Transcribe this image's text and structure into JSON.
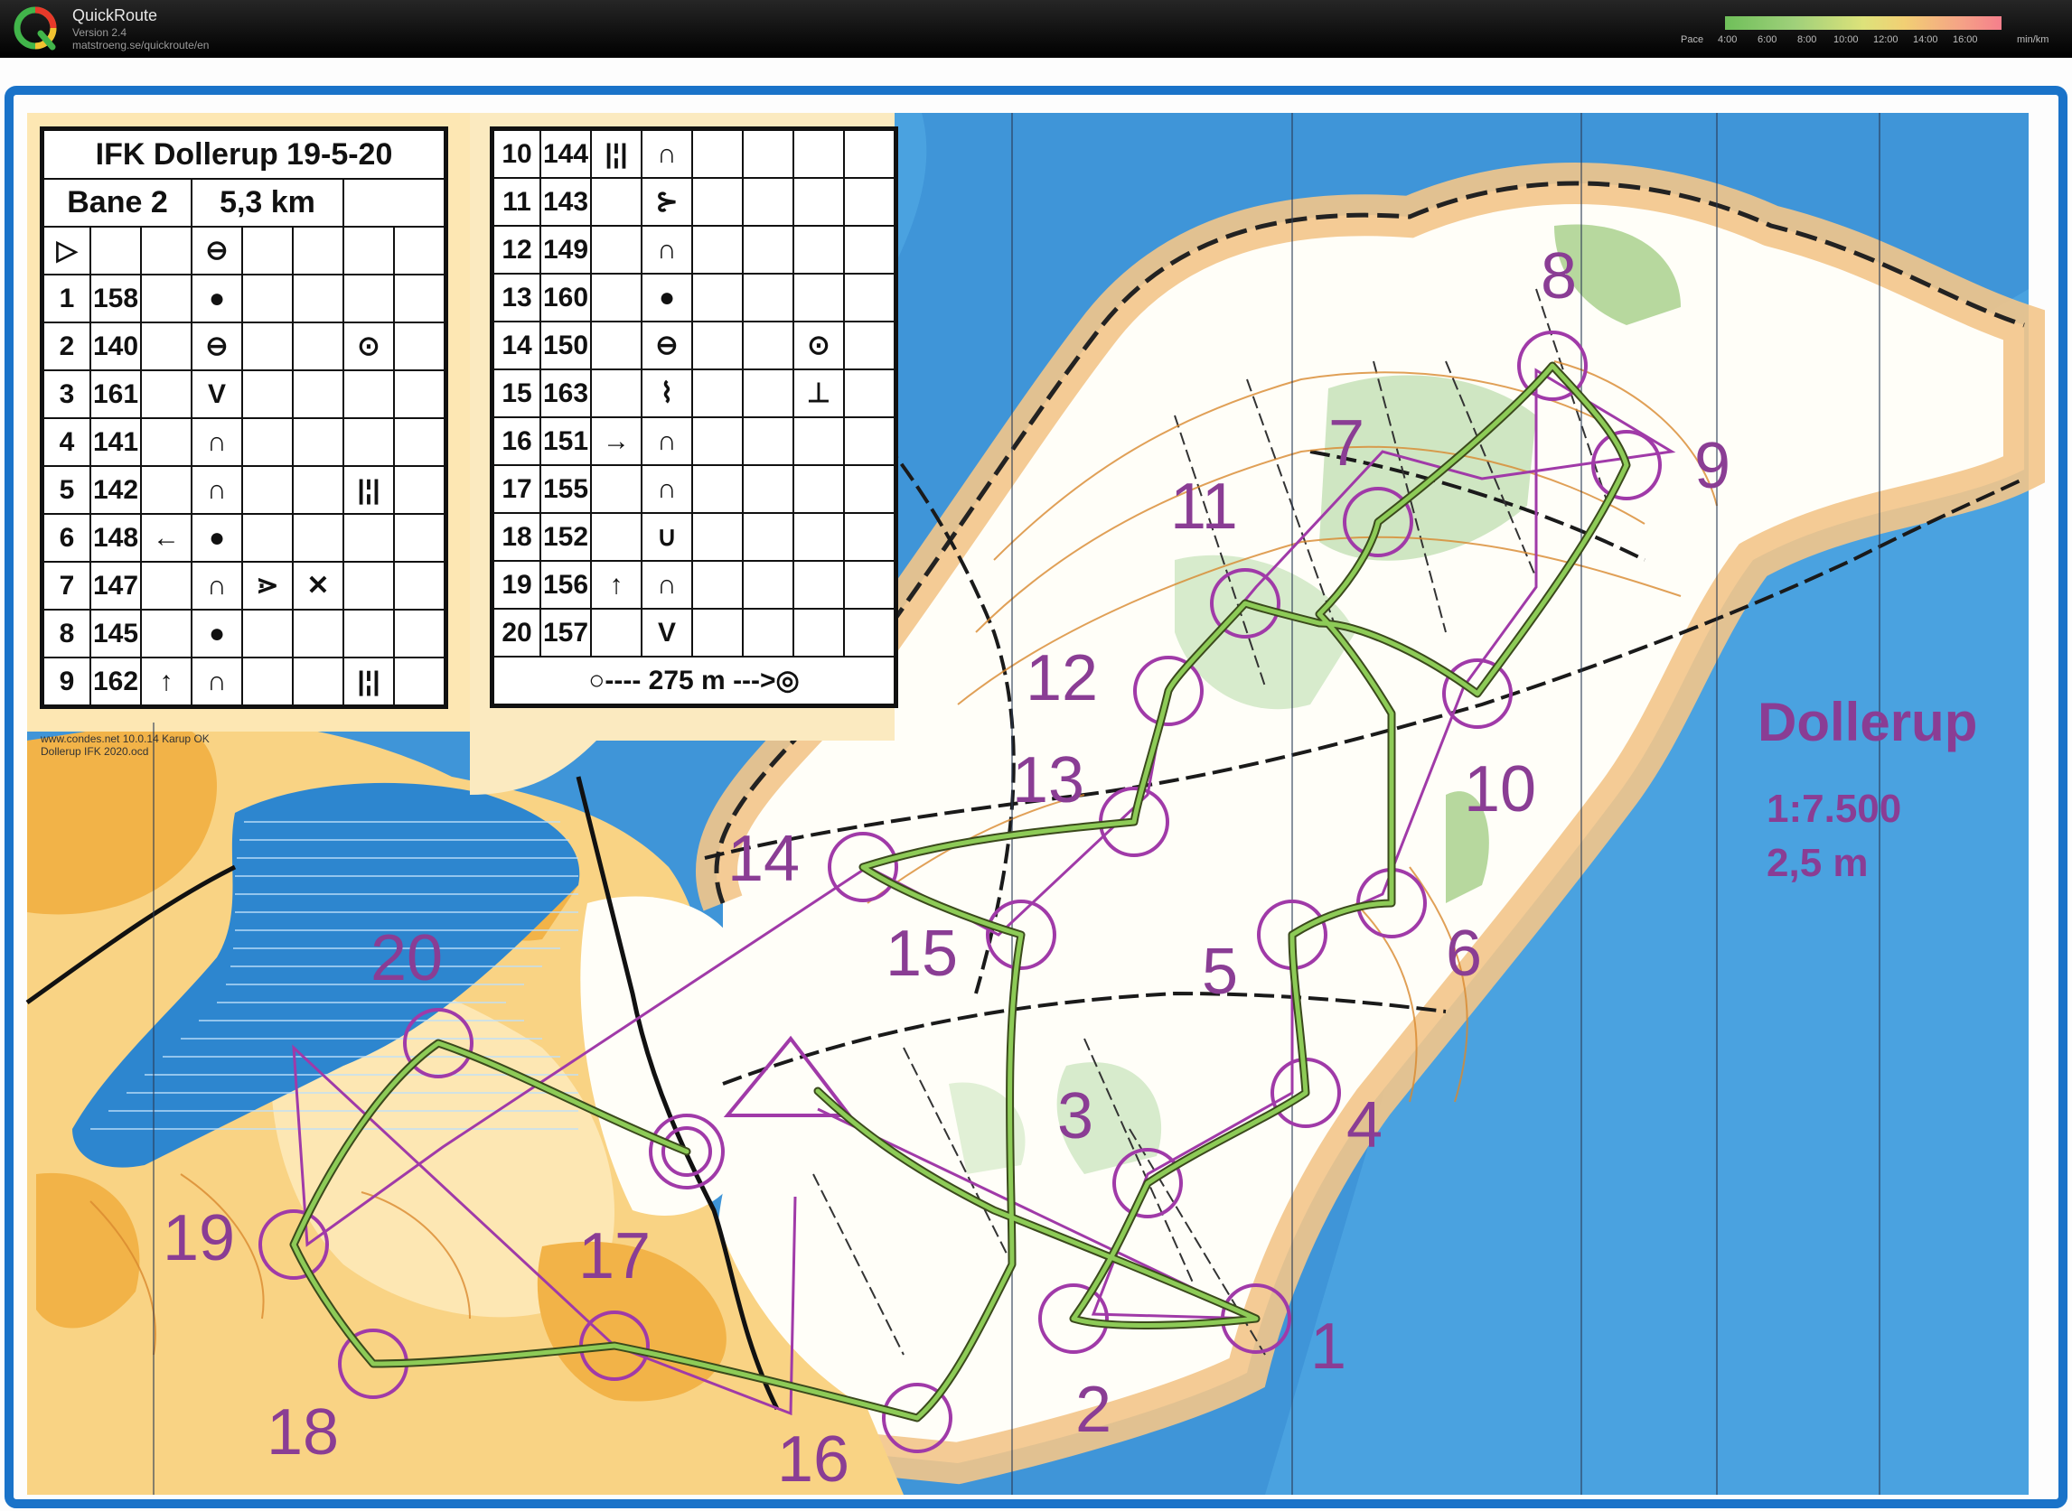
{
  "app": {
    "name": "QuickRoute",
    "version": "Version 2.4",
    "url": "matstroeng.se/quickroute/en"
  },
  "pace_legend": {
    "label": "Pace",
    "ticks": [
      "4:00",
      "6:00",
      "8:00",
      "10:00",
      "12:00",
      "14:00",
      "16:00"
    ],
    "unit": "min/km"
  },
  "map": {
    "name": "Dollerup",
    "scale": "1:7.500",
    "contour_interval": "2,5 m",
    "credit_line1": "www.condes.net 10.0.14 Karup OK",
    "credit_line2": "Dollerup IFK 2020.ocd",
    "control_numbers": [
      "1",
      "2",
      "3",
      "4",
      "5",
      "6",
      "7",
      "8",
      "9",
      "10",
      "11",
      "12",
      "13",
      "14",
      "15",
      "16",
      "17",
      "18",
      "19",
      "20"
    ]
  },
  "description_sheet": {
    "event": "IFK Dollerup 19-5-20",
    "course": "Bane 2",
    "length": "5,3 km",
    "start_symbol": "▷",
    "rows_part1": [
      {
        "num": "1",
        "code": "158",
        "col_d": "",
        "col_e": "●",
        "col_f": "",
        "col_g": "",
        "col_h": ""
      },
      {
        "num": "2",
        "code": "140",
        "col_d": "",
        "col_e": "⊖",
        "col_f": "",
        "col_g": "",
        "col_h": "⊙"
      },
      {
        "num": "3",
        "code": "161",
        "col_d": "",
        "col_e": "V",
        "col_f": "",
        "col_g": "",
        "col_h": ""
      },
      {
        "num": "4",
        "code": "141",
        "col_d": "",
        "col_e": "∩",
        "col_f": "",
        "col_g": "",
        "col_h": ""
      },
      {
        "num": "5",
        "code": "142",
        "col_d": "",
        "col_e": "∩",
        "col_f": "",
        "col_g": "",
        "col_h": "|¦|"
      },
      {
        "num": "6",
        "code": "148",
        "col_d": "←",
        "col_e": "●",
        "col_f": "",
        "col_g": "",
        "col_h": ""
      },
      {
        "num": "7",
        "code": "147",
        "col_d": "",
        "col_e": "∩",
        "col_f": "⋗",
        "col_g": "✕",
        "col_h": ""
      },
      {
        "num": "8",
        "code": "145",
        "col_d": "",
        "col_e": "●",
        "col_f": "",
        "col_g": "",
        "col_h": ""
      },
      {
        "num": "9",
        "code": "162",
        "col_d": "↑",
        "col_e": "∩",
        "col_f": "",
        "col_g": "",
        "col_h": "|¦|"
      }
    ],
    "rows_part2": [
      {
        "num": "10",
        "code": "144",
        "col_d": "|¦|",
        "col_e": "∩",
        "col_f": "",
        "col_g": "",
        "col_h": ""
      },
      {
        "num": "11",
        "code": "143",
        "col_d": "",
        "col_e": "⊱",
        "col_f": "",
        "col_g": "",
        "col_h": ""
      },
      {
        "num": "12",
        "code": "149",
        "col_d": "",
        "col_e": "∩",
        "col_f": "",
        "col_g": "",
        "col_h": ""
      },
      {
        "num": "13",
        "code": "160",
        "col_d": "",
        "col_e": "●",
        "col_f": "",
        "col_g": "",
        "col_h": ""
      },
      {
        "num": "14",
        "code": "150",
        "col_d": "",
        "col_e": "⊖",
        "col_f": "",
        "col_g": "",
        "col_h": "⊙"
      },
      {
        "num": "15",
        "code": "163",
        "col_d": "",
        "col_e": "⌇",
        "col_f": "",
        "col_g": "",
        "col_h": "⊥"
      },
      {
        "num": "16",
        "code": "151",
        "col_d": "→",
        "col_e": "∩",
        "col_f": "",
        "col_g": "",
        "col_h": ""
      },
      {
        "num": "17",
        "code": "155",
        "col_d": "",
        "col_e": "∩",
        "col_f": "",
        "col_g": "",
        "col_h": ""
      },
      {
        "num": "18",
        "code": "152",
        "col_d": "",
        "col_e": "∪",
        "col_f": "",
        "col_g": "",
        "col_h": ""
      },
      {
        "num": "19",
        "code": "156",
        "col_d": "↑",
        "col_e": "∩",
        "col_f": "",
        "col_g": "",
        "col_h": ""
      },
      {
        "num": "20",
        "code": "157",
        "col_d": "",
        "col_e": "V",
        "col_f": "",
        "col_g": "",
        "col_h": ""
      }
    ],
    "finish_text": "○---- 275 m --->◎"
  }
}
